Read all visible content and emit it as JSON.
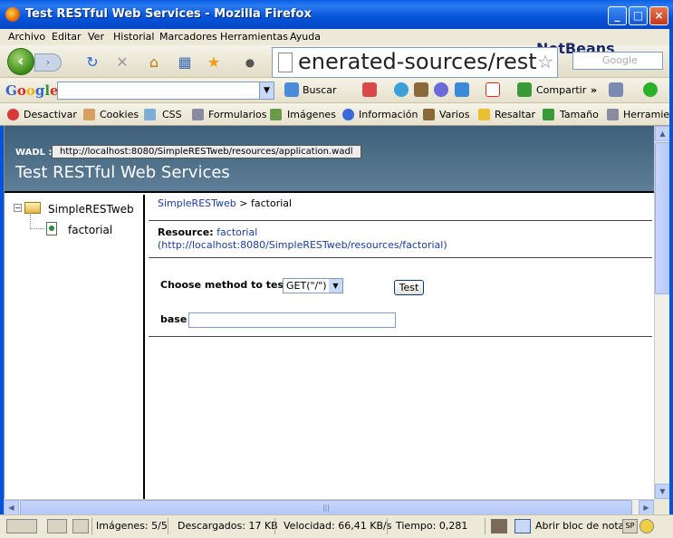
{
  "window": {
    "title": "Test RESTful Web Services - Mozilla Firefox"
  },
  "menubar": [
    "Archivo",
    "Editar",
    "Ver",
    "Historial",
    "Marcadores",
    "Herramientas",
    "Ayuda"
  ],
  "navbar": {
    "url": "enerated-sources/rest-t",
    "search_placeholder": "Google",
    "logo_text": "NetBeans"
  },
  "google_toolbar": {
    "logo": "Google",
    "search_label": "Buscar",
    "share_label": "Compartir",
    "more": "»"
  },
  "webdev_toolbar": {
    "items": [
      "Desactivar",
      "Cookies",
      "CSS",
      "Formularios",
      "Imágenes",
      "Información",
      "Varios",
      "Resaltar",
      "Tamaño",
      "Herramien"
    ]
  },
  "page": {
    "wadl_label": "WADL :",
    "wadl_url": "http://localhost:8080/SimpleRESTweb/resources/application.wadl",
    "title": "Test RESTful Web Services",
    "tree": {
      "root": "SimpleRESTweb",
      "child": "factorial"
    },
    "breadcrumb": {
      "root": "SimpleRESTweb",
      "sep": " > ",
      "current": "factorial"
    },
    "resource": {
      "label": "Resource:",
      "name": "factorial",
      "url": "(http://localhost:8080/SimpleRESTweb/resources/factorial)"
    },
    "form": {
      "method_label": "Choose method to test:",
      "method_value": "GET(\"/\")",
      "test_button": "Test",
      "base_label": "base",
      "base_value": ""
    }
  },
  "statusbar": {
    "images": "Imágenes: 5/5",
    "downloaded": "Descargados: 17 KB",
    "speed": "Velocidad: 66,41 KB/s",
    "time": "Tiempo: 0,281",
    "notepad": "Abrir bloc de notas"
  },
  "colors": {
    "titlebar": "#0553d9",
    "header_bg": "#4b6b85",
    "link": "#1a3d99"
  }
}
